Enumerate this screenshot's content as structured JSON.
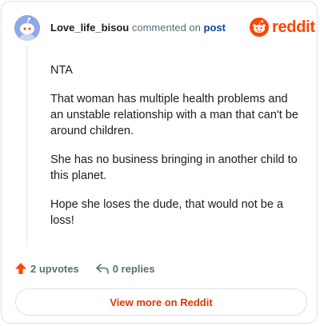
{
  "comment": {
    "username": "Love_life_bisou",
    "action_text": "commented on",
    "post_link": "post",
    "paragraphs": [
      "NTA",
      "That woman has multiple health problems and an unstable relationship with a man that can't be around children.",
      "She has no business bringing in another child to this planet.",
      "Hope she loses the dude, that would not be a loss!"
    ]
  },
  "brand": {
    "name": "reddit",
    "color": "#ff4500"
  },
  "actions": {
    "upvotes_label": "2 upvotes",
    "replies_label": "0 replies"
  },
  "view_more_label": "View more on Reddit",
  "icons": {
    "avatar": "snoo-avatar-icon",
    "logo": "reddit-snoo-icon",
    "upvote": "upvote-arrow-icon",
    "reply": "reply-arrow-icon"
  }
}
